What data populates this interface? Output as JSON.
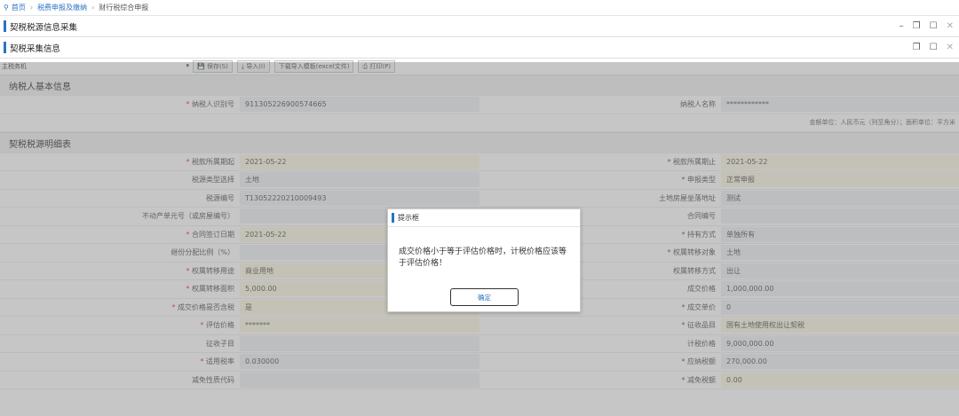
{
  "breadcrumb": {
    "home": "首页",
    "level2": "税费申报及缴纳",
    "current": "财行税综合申报"
  },
  "window": {
    "title": "契税税源信息采集",
    "subtitle": "契税采集信息"
  },
  "toolbar": {
    "select_label": "主税务机",
    "buttons": [
      "保存(S)",
      "导入(I)",
      "下载导入模板(excel文件)",
      "打印(P)"
    ]
  },
  "taxpayer_section": {
    "title": "纳税人基本信息",
    "id_label": "纳税人识别号",
    "id_value": "9113052269005746​65",
    "name_label": "纳税人名称",
    "name_value": "************",
    "unit_note": "金额单位：人民币元（列至角分）；面积单位：平方米"
  },
  "detail_section": {
    "title": "契税税源明细表",
    "rows": [
      {
        "l": "税款所属期起",
        "req": true,
        "v": "2021-05-22",
        "l2": "税款所属期止",
        "req2": true,
        "v2": "2021-05-22"
      },
      {
        "l": "税源类型选择",
        "req": false,
        "v": "土地",
        "l2": "申报类型",
        "req2": true,
        "v2": "正常申报"
      },
      {
        "l": "税源编号",
        "req": false,
        "v": "T13052220210009493",
        "l2": "土地房屋坐落地址",
        "req2": false,
        "v2": "测试"
      },
      {
        "l": "不动产单元号（或房屋编号）",
        "req": false,
        "v": "",
        "l2": "合同编号",
        "req2": false,
        "v2": ""
      },
      {
        "l": "合同签订日期",
        "req": true,
        "v": "2021-05-22",
        "l2": "持有方式",
        "req2": true,
        "v2": "单独所有"
      },
      {
        "l": "继份分配比例（%）",
        "req": false,
        "v": "",
        "l2": "权属转移对象",
        "req2": true,
        "v2": "土地"
      },
      {
        "l": "权属转移用途",
        "req": true,
        "v": "商业用地",
        "l2": "权属转移方式",
        "req2": false,
        "v2": "出让"
      },
      {
        "l": "权属转移面积",
        "req": true,
        "v": "5,000.00",
        "l2": "成交价格",
        "req2": false,
        "v2": "1,000,000.00"
      },
      {
        "l": "成交价格是否含税",
        "req": true,
        "v": "是",
        "l2": "成交单价",
        "req2": true,
        "v2": "0"
      },
      {
        "l": "评估价格",
        "req": true,
        "v": "*******",
        "l2": "征收品目",
        "req2": true,
        "v2": "国有土地使用权出让契税"
      },
      {
        "l": "征收子目",
        "req": false,
        "v": "",
        "l2": "计税价格",
        "req2": false,
        "v2": "9,000,000.00"
      },
      {
        "l": "适用税率",
        "req": true,
        "v": "0.030000",
        "l2": "应纳税额",
        "req2": true,
        "v2": "270,000.00"
      },
      {
        "l": "减免性质代码",
        "req": false,
        "v": "",
        "l2": "减免税额",
        "req2": true,
        "v2": "0.00"
      }
    ]
  },
  "dialog": {
    "title": "提示框",
    "message": "成交价格小于等于评估价格时，计税价格应该等于评估价格！",
    "ok_label": "确定"
  }
}
